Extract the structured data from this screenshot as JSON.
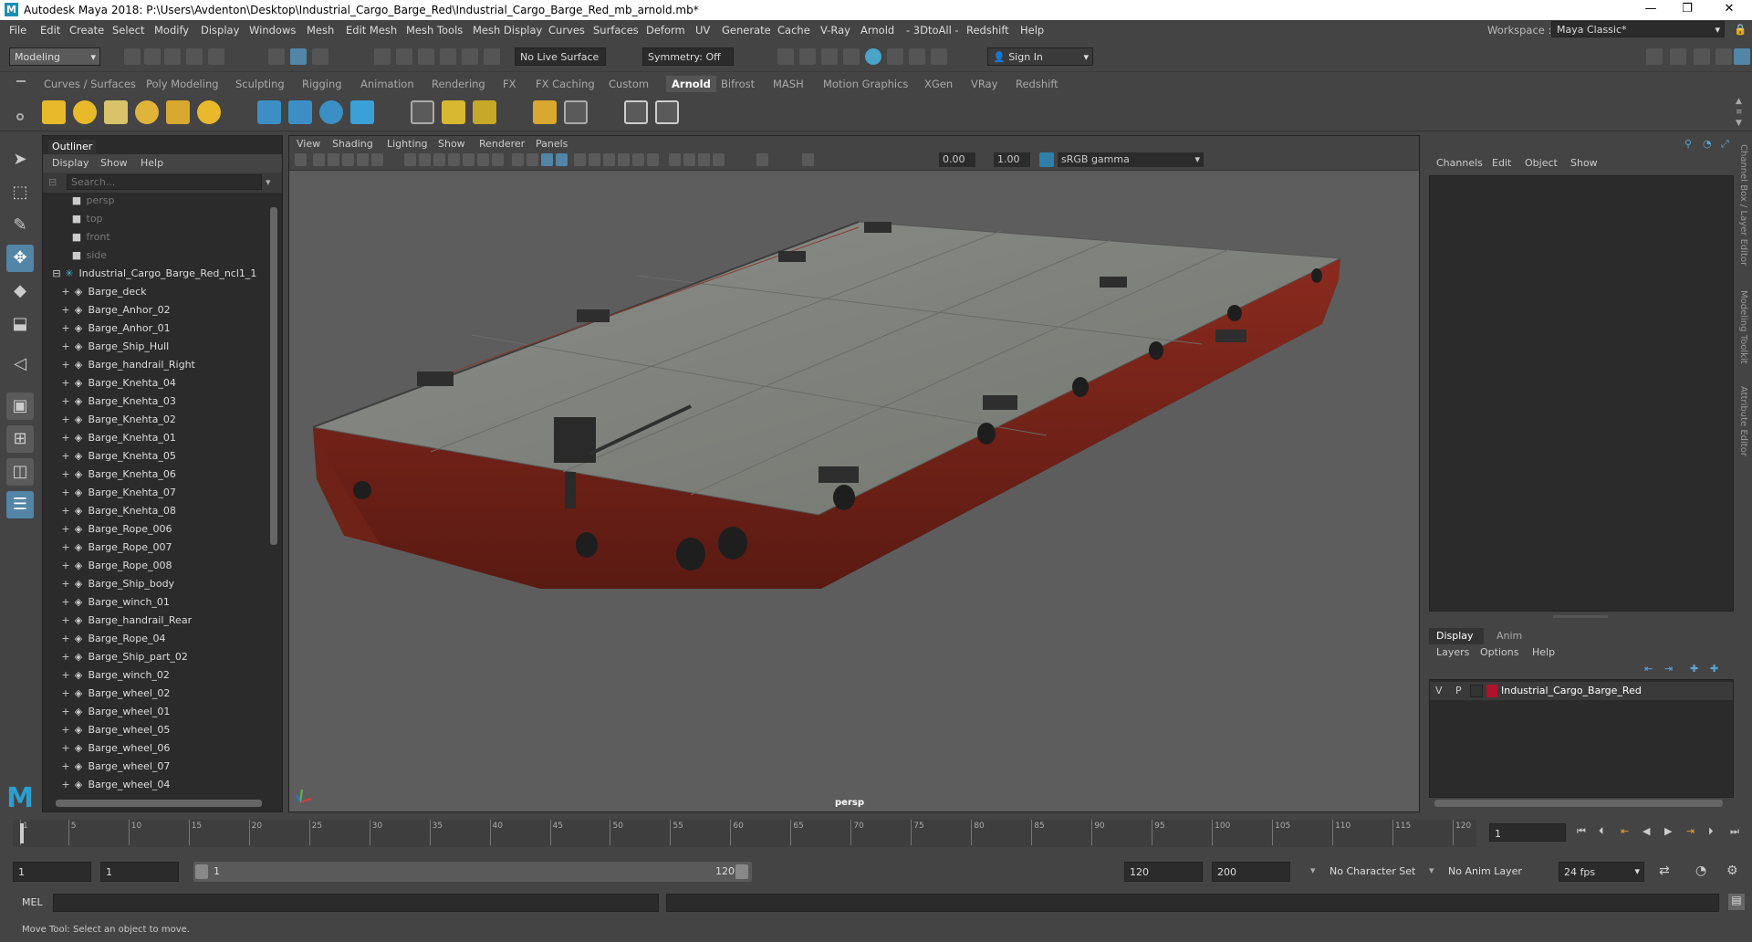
{
  "window": {
    "title": "Autodesk Maya 2018: P:\\Users\\Avdenton\\Desktop\\Industrial_Cargo_Barge_Red\\Industrial_Cargo_Barge_Red_mb_arnold.mb*",
    "logo": "M",
    "controls": {
      "minimize": "—",
      "maximize": "❐",
      "close": "✕"
    }
  },
  "menubar": [
    "File",
    "Edit",
    "Create",
    "Select",
    "Modify",
    "Display",
    "Windows",
    "Mesh",
    "Edit Mesh",
    "Mesh Tools",
    "Mesh Display",
    "Curves",
    "Surfaces",
    "Deform",
    "UV",
    "Generate",
    "Cache",
    "V-Ray",
    "Arnold",
    "- 3DtoAll -",
    "Redshift",
    "Help"
  ],
  "workspace": {
    "label": "Workspace :",
    "value": "Maya Classic*"
  },
  "statusline": {
    "menuset": "Modeling",
    "live_surface": "No Live Surface",
    "symmetry": "Symmetry: Off",
    "sign_in": "Sign In"
  },
  "shelf_tabs": [
    "Curves / Surfaces",
    "Poly Modeling",
    "Sculpting",
    "Rigging",
    "Animation",
    "Rendering",
    "FX",
    "FX Caching",
    "Custom",
    "Arnold",
    "Bifrost",
    "MASH",
    "Motion Graphics",
    "XGen",
    "VRay",
    "Redshift"
  ],
  "shelf_active": "Arnold",
  "outliner": {
    "title": "Outliner",
    "menu": [
      "Display",
      "Show",
      "Help"
    ],
    "search_placeholder": "Search...",
    "cameras": [
      "persp",
      "top",
      "front",
      "side"
    ],
    "group": "Industrial_Cargo_Barge_Red_ncl1_1",
    "items": [
      "Barge_deck",
      "Barge_Anhor_02",
      "Barge_Anhor_01",
      "Barge_Ship_Hull",
      "Barge_handrail_Right",
      "Barge_Knehta_04",
      "Barge_Knehta_03",
      "Barge_Knehta_02",
      "Barge_Knehta_01",
      "Barge_Knehta_05",
      "Barge_Knehta_06",
      "Barge_Knehta_07",
      "Barge_Knehta_08",
      "Barge_Rope_006",
      "Barge_Rope_007",
      "Barge_Rope_008",
      "Barge_Ship_body",
      "Barge_winch_01",
      "Barge_handrail_Rear",
      "Barge_Rope_04",
      "Barge_Ship_part_02",
      "Barge_winch_02",
      "Barge_wheel_02",
      "Barge_wheel_01",
      "Barge_wheel_05",
      "Barge_wheel_06",
      "Barge_wheel_07",
      "Barge_wheel_04"
    ]
  },
  "viewport": {
    "menu": [
      "View",
      "Shading",
      "Lighting",
      "Show",
      "Renderer",
      "Panels"
    ],
    "exposure": "0.00",
    "gamma": "1.00",
    "colorspace": "sRGB gamma",
    "camera_label": "persp"
  },
  "channelbox": {
    "menu": [
      "Channels",
      "Edit",
      "Object",
      "Show"
    ],
    "tabs": [
      "Display",
      "Anim"
    ],
    "layer_menu": [
      "Layers",
      "Options",
      "Help"
    ],
    "layer": {
      "v": "V",
      "p": "P",
      "name": "Industrial_Cargo_Barge_Red",
      "color": "#b0122a"
    },
    "side_tabs": [
      "Channel Box / Layer Editor",
      "Modeling Toolkit",
      "Attribute Editor"
    ]
  },
  "timeline": {
    "ticks": [
      "1",
      "5",
      "10",
      "15",
      "20",
      "25",
      "30",
      "35",
      "40",
      "45",
      "50",
      "55",
      "60",
      "65",
      "70",
      "75",
      "80",
      "85",
      "90",
      "95",
      "100",
      "105",
      "110",
      "115",
      "120"
    ],
    "current_frame": "1"
  },
  "range": {
    "start": "1",
    "playback_start": "1",
    "slider_start": "1",
    "slider_end": "120",
    "playback_end": "120",
    "end": "200",
    "character_set": "No Character Set",
    "anim_layer": "No Anim Layer",
    "fps": "24 fps"
  },
  "cmdline": {
    "label": "MEL"
  },
  "helpline": "Move Tool: Select an object to move."
}
